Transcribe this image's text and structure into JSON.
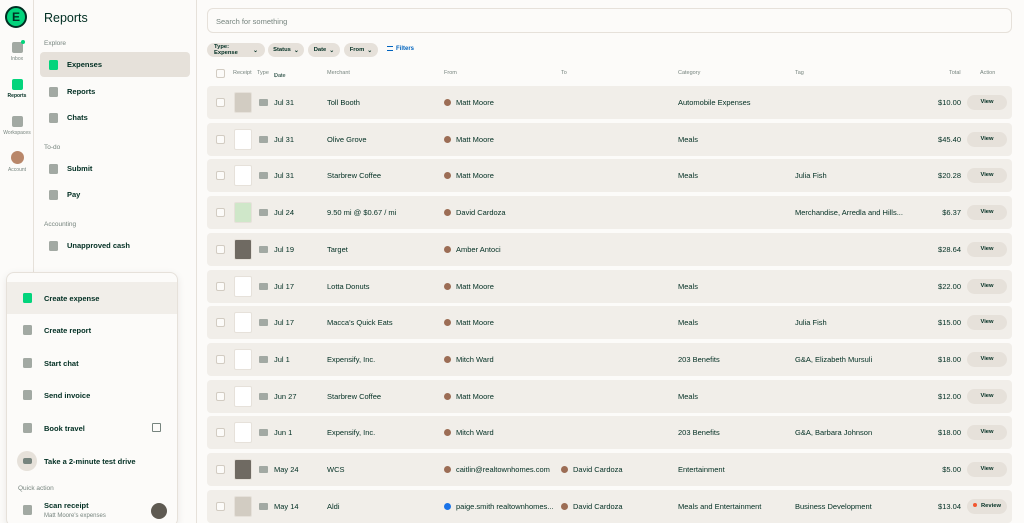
{
  "rail": {
    "logo": "E",
    "items": [
      {
        "label": "Inbox",
        "icon": "inbox-icon"
      },
      {
        "label": "Reports",
        "icon": "reports-icon",
        "active": true
      },
      {
        "label": "Workspaces",
        "icon": "buildings-icon"
      },
      {
        "label": "Account",
        "icon": "avatar"
      }
    ]
  },
  "sidebar": {
    "title": "Reports",
    "explore_label": "Explore",
    "explore": [
      {
        "label": "Expenses",
        "icon": "receipt-icon",
        "active": true
      },
      {
        "label": "Reports",
        "icon": "document-icon"
      },
      {
        "label": "Chats",
        "icon": "chat-bubbles-icon"
      }
    ],
    "todo_label": "To-do",
    "todo": [
      {
        "label": "Submit",
        "icon": "pencil-icon"
      },
      {
        "label": "Pay",
        "icon": "money-bag-icon"
      }
    ],
    "accounting_label": "Accounting",
    "accounting": [
      {
        "label": "Unapproved cash",
        "icon": "cash-icon"
      }
    ]
  },
  "menu": {
    "items": [
      {
        "label": "Create expense",
        "icon": "receipt-icon",
        "active": true
      },
      {
        "label": "Create report",
        "icon": "document-icon"
      },
      {
        "label": "Start chat",
        "icon": "chat-bubble-icon"
      },
      {
        "label": "Send invoice",
        "icon": "invoice-icon"
      },
      {
        "label": "Book travel",
        "icon": "suitcase-icon"
      },
      {
        "label": "Take a 2-minute test drive",
        "icon": "car-icon"
      }
    ],
    "quick_action_label": "Quick action",
    "scan": {
      "label": "Scan receipt",
      "sub": "Matt Moore's expenses"
    }
  },
  "search": {
    "placeholder": "Search for something"
  },
  "filters": {
    "chips": [
      "Type: Expense",
      "Status",
      "Date",
      "From"
    ],
    "link": "Filters"
  },
  "table": {
    "headers": {
      "receipt": "Receipt",
      "type": "Type",
      "date": "Date",
      "merchant": "Merchant",
      "from": "From",
      "to": "To",
      "category": "Category",
      "tag": "Tag",
      "total": "Total",
      "action": "Action"
    },
    "rows": [
      {
        "date": "Jul 31",
        "merchant": "Toll Booth",
        "from": "Matt Moore",
        "to": "",
        "category": "Automobile Expenses",
        "tag": "",
        "total": "$10.00",
        "action": "View",
        "receipt": "gray"
      },
      {
        "date": "Jul 31",
        "merchant": "Olive Grove",
        "from": "Matt Moore",
        "to": "",
        "category": "Meals",
        "tag": "",
        "total": "$45.40",
        "action": "View",
        "receipt": "paper"
      },
      {
        "date": "Jul 31",
        "merchant": "Starbrew Coffee",
        "from": "Matt Moore",
        "to": "",
        "category": "Meals",
        "tag": "Julia Fish",
        "total": "$20.28",
        "action": "View",
        "receipt": "paper"
      },
      {
        "date": "Jul 24",
        "merchant": "9.50 mi @ $0.67 / mi",
        "from": "David Cardoza",
        "to": "",
        "category": "",
        "tag": "Merchandise, Arredla and Hills...",
        "total": "$6.37",
        "action": "View",
        "receipt": "map"
      },
      {
        "date": "Jul 19",
        "merchant": "Target",
        "from": "Amber Antoci",
        "to": "",
        "category": "",
        "tag": "",
        "total": "$28.64",
        "action": "View",
        "receipt": "dark"
      },
      {
        "date": "Jul 17",
        "merchant": "Lotta Donuts",
        "from": "Matt Moore",
        "to": "",
        "category": "Meals",
        "tag": "",
        "total": "$22.00",
        "action": "View",
        "receipt": "paper"
      },
      {
        "date": "Jul 17",
        "merchant": "Macca's Quick Eats",
        "from": "Matt Moore",
        "to": "",
        "category": "Meals",
        "tag": "Julia Fish",
        "total": "$15.00",
        "action": "View",
        "receipt": "paper"
      },
      {
        "date": "Jul 1",
        "merchant": "Expensify, Inc.",
        "from": "Mitch Ward",
        "to": "",
        "category": "203 Benefits",
        "tag": "G&A, Elizabeth Mursuli",
        "total": "$18.00",
        "action": "View",
        "receipt": "paper"
      },
      {
        "date": "Jun 27",
        "merchant": "Starbrew Coffee",
        "from": "Matt Moore",
        "to": "",
        "category": "Meals",
        "tag": "",
        "total": "$12.00",
        "action": "View",
        "receipt": "paper"
      },
      {
        "date": "Jun 1",
        "merchant": "Expensify, Inc.",
        "from": "Mitch Ward",
        "to": "",
        "category": "203 Benefits",
        "tag": "G&A, Barbara Johnson",
        "total": "$18.00",
        "action": "View",
        "receipt": "paper"
      },
      {
        "date": "May 24",
        "merchant": "WCS",
        "from": "caitlin@realtownhomes.com",
        "to": "David Cardoza",
        "category": "Entertainment",
        "tag": "",
        "total": "$5.00",
        "action": "View",
        "receipt": "dark"
      },
      {
        "date": "May 14",
        "merchant": "Aldi",
        "from": "paige.smith realtownhomes...",
        "to": "David Cardoza",
        "category": "Meals and Entertainment",
        "tag": "Business Development",
        "total": "$13.04",
        "action": "Review",
        "receipt": "gray"
      }
    ]
  },
  "colors": {
    "accent": "#03d47c",
    "link": "#0164bf",
    "review_dot": "#f25730",
    "row_bg": "#f1eee9"
  }
}
